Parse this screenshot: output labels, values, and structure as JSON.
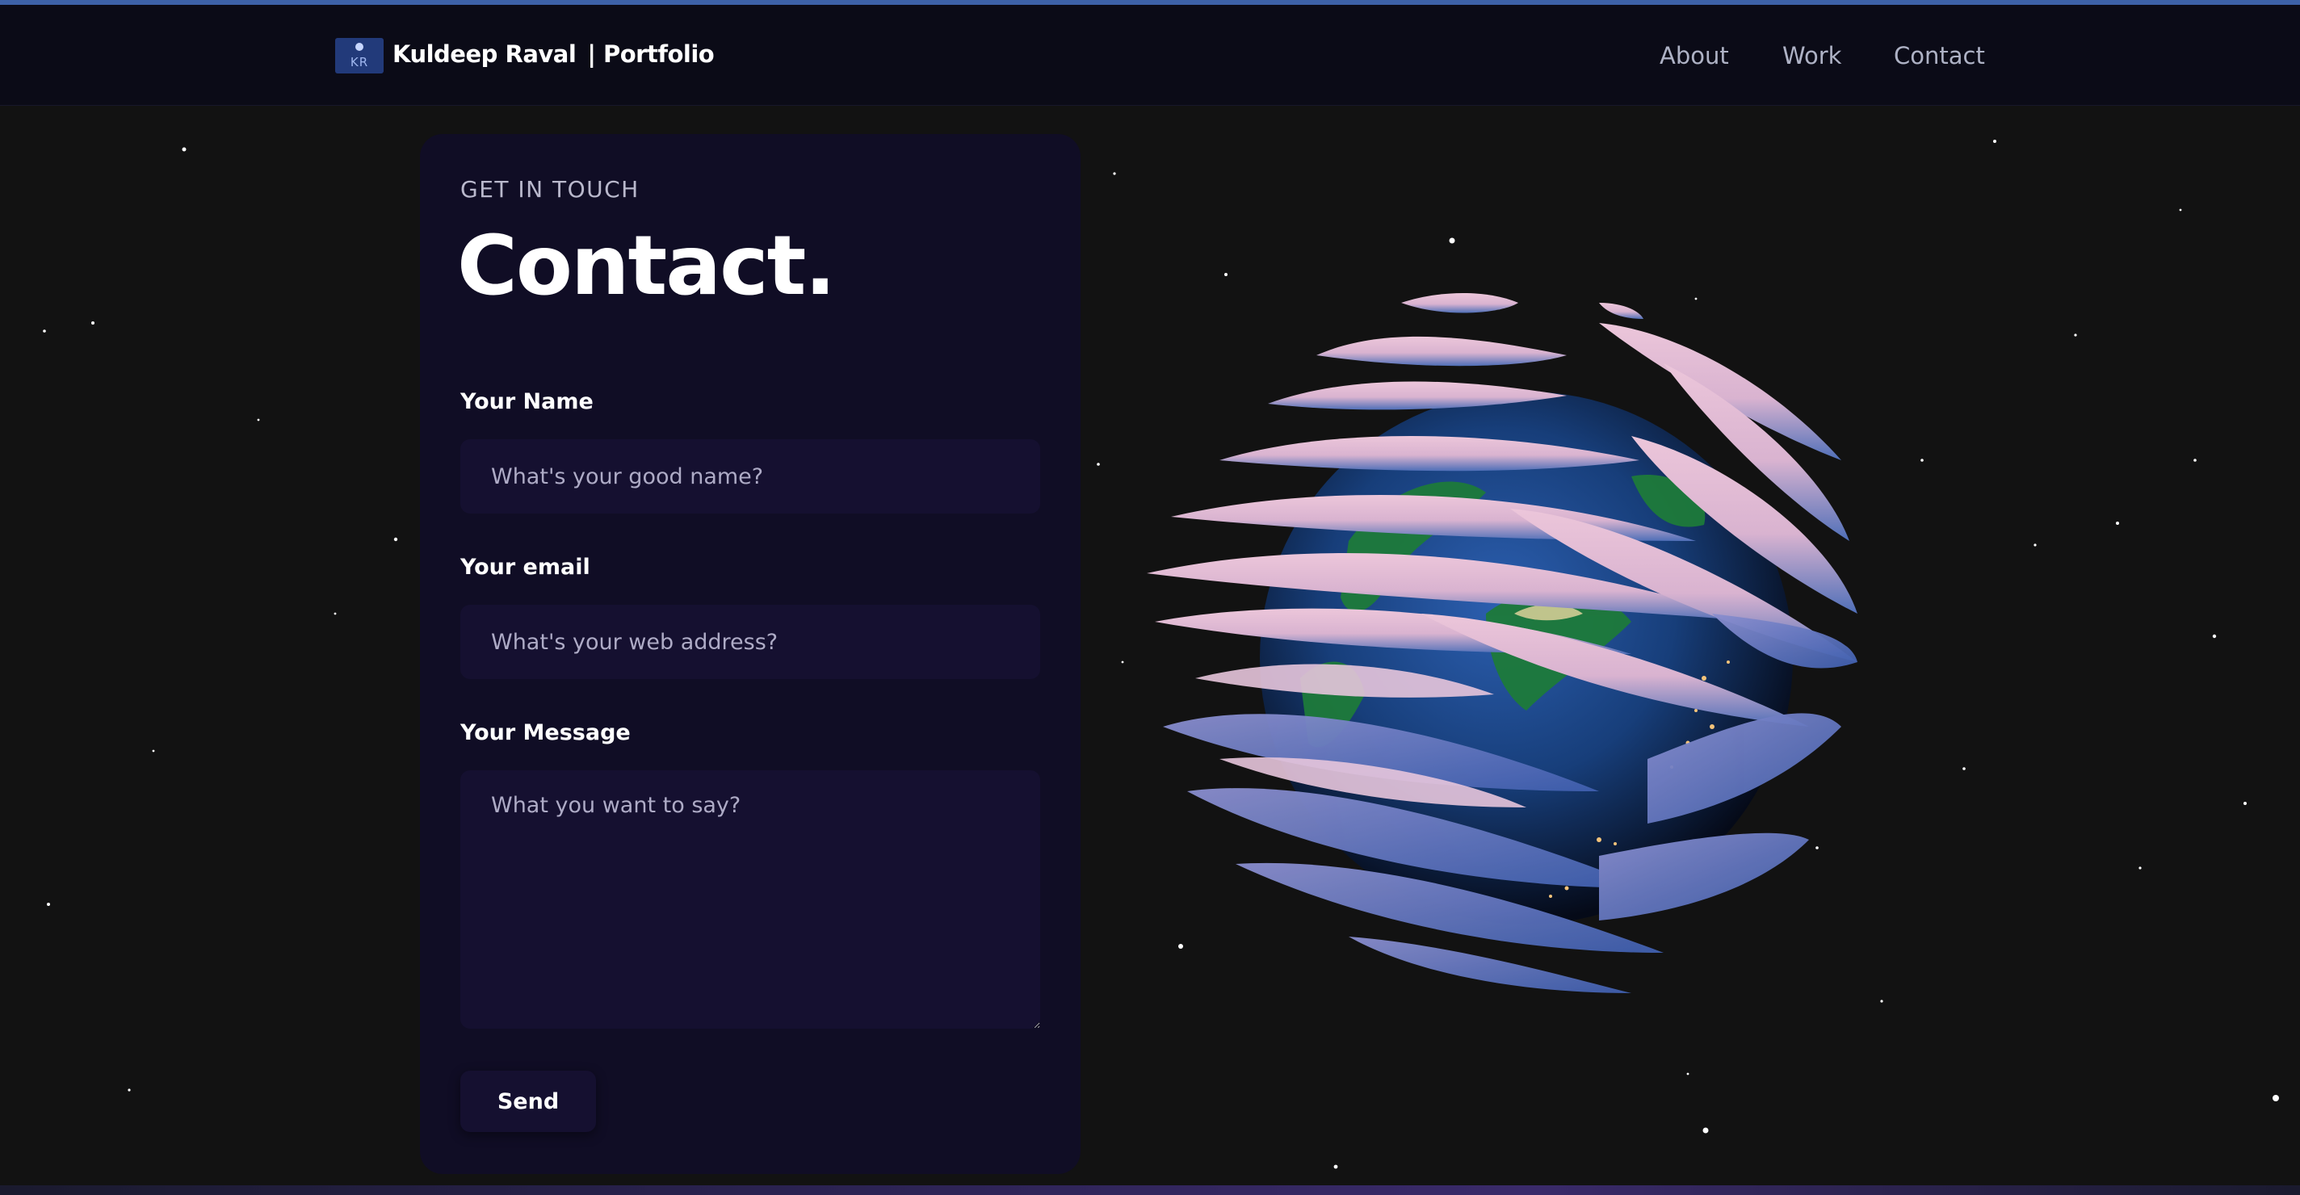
{
  "window": {
    "accent_color": "#3d62a8"
  },
  "navbar": {
    "logo_initials": "KR",
    "brand_name": "Kuldeep Raval",
    "brand_suffix": "| Portfolio",
    "links": [
      {
        "label": "About"
      },
      {
        "label": "Work"
      },
      {
        "label": "Contact"
      }
    ]
  },
  "contact": {
    "subtitle": "GET IN TOUCH",
    "title": "Contact.",
    "fields": {
      "name": {
        "label": "Your Name",
        "placeholder": "What's your good name?",
        "value": ""
      },
      "email": {
        "label": "Your email",
        "placeholder": "What's your web address?",
        "value": ""
      },
      "message": {
        "label": "Your Message",
        "placeholder": "What you want to say?",
        "value": ""
      }
    },
    "send_label": "Send"
  },
  "scene": {
    "object": "globe-icon",
    "colors": {
      "background": "#121212",
      "card": "#100d25",
      "input": "#151030",
      "swirl_pink": "#e6bfd6",
      "swirl_blue": "#4f6fb8"
    }
  }
}
